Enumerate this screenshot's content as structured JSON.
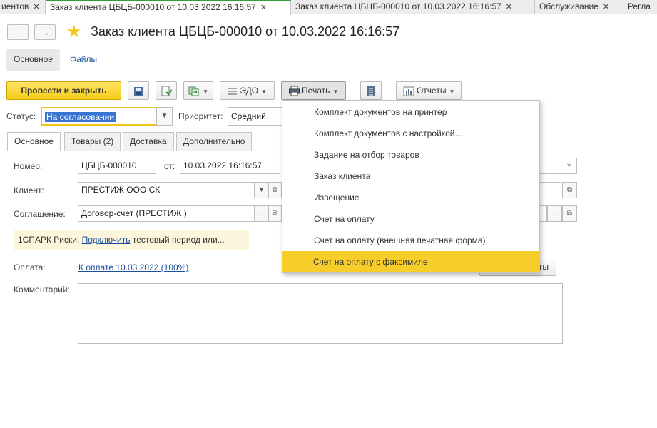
{
  "window_tabs": [
    {
      "label": "иентов",
      "closable": true
    },
    {
      "label": "Заказ клиента ЦБЦБ-000010 от 10.03.2022 16:16:57",
      "closable": true,
      "active": true
    },
    {
      "label": "Заказ клиента ЦБЦБ-000010 от 10.03.2022 16:16:57",
      "closable": true
    },
    {
      "label": "Обслуживание",
      "closable": true
    },
    {
      "label": "Регла",
      "closable": false
    }
  ],
  "close_glyph": "✕",
  "nav": {
    "back": "←",
    "forward": "→"
  },
  "title": "Заказ клиента ЦБЦБ-000010 от 10.03.2022 16:16:57",
  "section_tabs": {
    "main": "Основное",
    "files": "Файлы"
  },
  "toolbar": {
    "post_close": "Провести и закрыть",
    "edo": "ЭДО",
    "print": "Печать",
    "reports": "Отчеты"
  },
  "status": {
    "label": "Статус:",
    "value": "На согласовании"
  },
  "priority": {
    "label": "Приоритет:",
    "value": "Средний"
  },
  "form_tabs": [
    "Основное",
    "Товары (2)",
    "Доставка",
    "Дополнительно"
  ],
  "number": {
    "label": "Номер:",
    "value": "ЦБЦБ-000010",
    "from_label": "от:",
    "date": "10.03.2022 16:16:57"
  },
  "client": {
    "label": "Клиент:",
    "value": "ПРЕСТИЖ ООО СК"
  },
  "agreement": {
    "label": "Соглашение:",
    "value": "Договор-счет (ПРЕСТИЖ )"
  },
  "spark": {
    "prefix": "1СПАРК Риски:",
    "link": "Подключить",
    "suffix": "тестовый период или..."
  },
  "payment": {
    "label": "Оплата:",
    "link": "К оплате 10.03.2022 (100%)",
    "button_tail": "ты"
  },
  "comment": {
    "label": "Комментарий:",
    "value": ""
  },
  "print_menu": {
    "items": [
      "Комплект документов на принтер",
      "Комплект документов с настройкой...",
      "Задание на отбор товаров",
      "Заказ клиента",
      "Извещение",
      "Счет на оплату",
      "Счет на оплату (внешняя печатная форма)",
      "Счет на оплату с факсимиле"
    ],
    "highlighted_index": 7
  },
  "colors": {
    "accent": "#f6cc1a",
    "highlight": "#f7cd2a",
    "link": "#1a4fa0",
    "active_tab": "#3a9a3a",
    "selection": "#3874d1"
  },
  "icons": [
    "arrow-left-icon",
    "arrow-right-icon",
    "star-icon",
    "save-icon",
    "document-post-icon",
    "create-based-on-icon",
    "edo-icon",
    "printer-icon",
    "list-icon",
    "reports-icon"
  ]
}
